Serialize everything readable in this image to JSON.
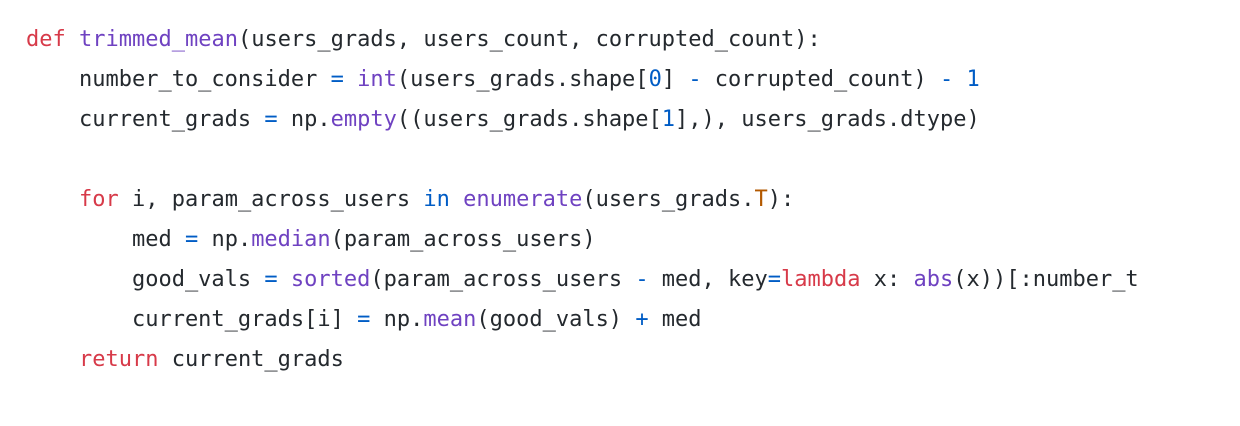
{
  "code": {
    "lines": [
      [
        {
          "t": "def",
          "c": "kw"
        },
        {
          "t": " ",
          "c": ""
        },
        {
          "t": "trimmed_mean",
          "c": "fn"
        },
        {
          "t": "(users_grads, users_count, corrupted_count):",
          "c": ""
        }
      ],
      [
        {
          "t": "    number_to_consider ",
          "c": ""
        },
        {
          "t": "=",
          "c": "op"
        },
        {
          "t": " ",
          "c": ""
        },
        {
          "t": "int",
          "c": "fn"
        },
        {
          "t": "(users_grads.shape[",
          "c": ""
        },
        {
          "t": "0",
          "c": "num"
        },
        {
          "t": "] ",
          "c": ""
        },
        {
          "t": "-",
          "c": "op"
        },
        {
          "t": " corrupted_count) ",
          "c": ""
        },
        {
          "t": "-",
          "c": "op"
        },
        {
          "t": " ",
          "c": ""
        },
        {
          "t": "1",
          "c": "num"
        }
      ],
      [
        {
          "t": "    current_grads ",
          "c": ""
        },
        {
          "t": "=",
          "c": "op"
        },
        {
          "t": " np.",
          "c": ""
        },
        {
          "t": "empty",
          "c": "fn"
        },
        {
          "t": "((users_grads.shape[",
          "c": ""
        },
        {
          "t": "1",
          "c": "num"
        },
        {
          "t": "],), users_grads.dtype)",
          "c": ""
        }
      ],
      [],
      [
        {
          "t": "    ",
          "c": ""
        },
        {
          "t": "for",
          "c": "kw"
        },
        {
          "t": " i, param_across_users ",
          "c": ""
        },
        {
          "t": "in",
          "c": "op"
        },
        {
          "t": " ",
          "c": ""
        },
        {
          "t": "enumerate",
          "c": "fn"
        },
        {
          "t": "(users_grads.",
          "c": ""
        },
        {
          "t": "T",
          "c": "attrT"
        },
        {
          "t": "):",
          "c": ""
        }
      ],
      [
        {
          "t": "        med ",
          "c": ""
        },
        {
          "t": "=",
          "c": "op"
        },
        {
          "t": " np.",
          "c": ""
        },
        {
          "t": "median",
          "c": "fn"
        },
        {
          "t": "(param_across_users)",
          "c": ""
        }
      ],
      [
        {
          "t": "        good_vals ",
          "c": ""
        },
        {
          "t": "=",
          "c": "op"
        },
        {
          "t": " ",
          "c": ""
        },
        {
          "t": "sorted",
          "c": "fn"
        },
        {
          "t": "(param_across_users ",
          "c": ""
        },
        {
          "t": "-",
          "c": "op"
        },
        {
          "t": " med, key",
          "c": ""
        },
        {
          "t": "=",
          "c": "op"
        },
        {
          "t": "lambda",
          "c": "kw"
        },
        {
          "t": " x: ",
          "c": ""
        },
        {
          "t": "abs",
          "c": "fn"
        },
        {
          "t": "(x))[:number_t",
          "c": ""
        }
      ],
      [
        {
          "t": "        current_grads[i] ",
          "c": ""
        },
        {
          "t": "=",
          "c": "op"
        },
        {
          "t": " np.",
          "c": ""
        },
        {
          "t": "mean",
          "c": "fn"
        },
        {
          "t": "(good_vals) ",
          "c": ""
        },
        {
          "t": "+",
          "c": "op"
        },
        {
          "t": " med",
          "c": ""
        }
      ],
      [
        {
          "t": "    ",
          "c": ""
        },
        {
          "t": "return",
          "c": "kw"
        },
        {
          "t": " current_grads",
          "c": ""
        }
      ]
    ]
  }
}
